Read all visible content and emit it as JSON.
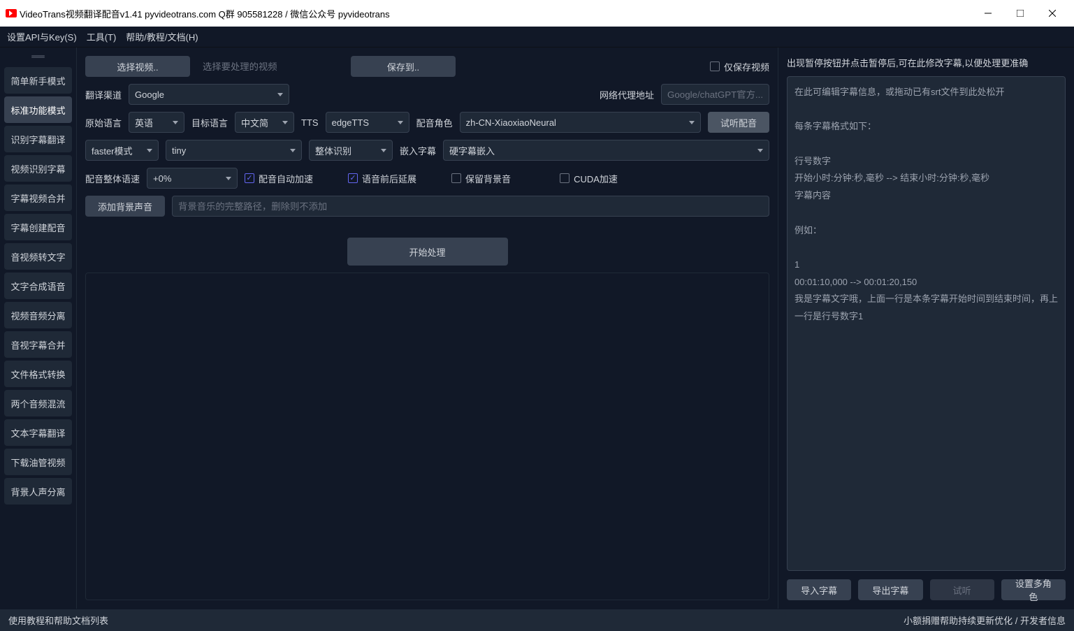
{
  "window": {
    "title": "VideoTrans视频翻译配音v1.41   pyvideotrans.com    Q群 905581228 / 微信公众号 pyvideotrans"
  },
  "menu": {
    "settings": "设置API与Key(S)",
    "tools": "工具(T)",
    "help": "帮助/教程/文档(H)"
  },
  "sidebar": {
    "items": [
      "简单新手模式",
      "标准功能模式",
      "识别字幕翻译",
      "视频识别字幕",
      "字幕视频合并",
      "字幕创建配音",
      "音视频转文字",
      "文字合成语音",
      "视频音频分离",
      "音视字幕合并",
      "文件格式转换",
      "两个音频混流",
      "文本字幕翻译",
      "下载油管视频",
      "背景人声分离"
    ],
    "active_index": 1
  },
  "top": {
    "select_video": "选择视频..",
    "select_video_placeholder": "选择要处理的视频",
    "save_to": "保存到..",
    "only_save_video": "仅保存视频"
  },
  "row1": {
    "channel_label": "翻译渠道",
    "channel_value": "Google",
    "proxy_label": "网络代理地址",
    "proxy_placeholder": "Google/chatGPT官方..."
  },
  "row2": {
    "src_lang_label": "原始语言",
    "src_lang_value": "英语",
    "tgt_lang_label": "目标语言",
    "tgt_lang_value": "中文简",
    "tts_label": "TTS",
    "tts_value": "edgeTTS",
    "voice_role_label": "配音角色",
    "voice_role_value": "zh-CN-XiaoxiaoNeural",
    "test_voice": "试听配音"
  },
  "row3": {
    "mode_value": "faster模式",
    "model_value": "tiny",
    "recog_value": "整体识别",
    "embed_label": "嵌入字幕",
    "embed_value": "硬字幕嵌入"
  },
  "row4": {
    "speed_label": "配音整体语速",
    "speed_value": "+0%",
    "auto_speed": "配音自动加速",
    "voice_ext": "语音前后延展",
    "keep_bg": "保留背景音",
    "cuda": "CUDA加速"
  },
  "row5": {
    "add_bg": "添加背景声音",
    "bg_placeholder": "背景音乐的完整路径，删除则不添加"
  },
  "start_btn": "开始处理",
  "right": {
    "title": "出现暂停按钮并点击暂停后,可在此修改字幕,以便处理更准确",
    "srt_text": "在此可编辑字幕信息，或拖动已有srt文件到此处松开\n\n每条字幕格式如下：\n\n行号数字\n开始小时:分钟:秒,毫秒 --> 结束小时:分钟:秒,毫秒\n字幕内容\n\n例如：\n\n1\n00:01:10,000 --> 00:01:20,150\n我是字幕文字哦，上面一行是本条字幕开始时间到结束时间，再上一行是行号数字1",
    "import_srt": "导入字幕",
    "export_srt": "导出字幕",
    "preview": "试听",
    "multi_role": "设置多角色"
  },
  "status": {
    "left": "使用教程和帮助文档列表",
    "right_donate": "小额捐赠帮助持续更新优化",
    "right_dev": "开发者信息"
  }
}
